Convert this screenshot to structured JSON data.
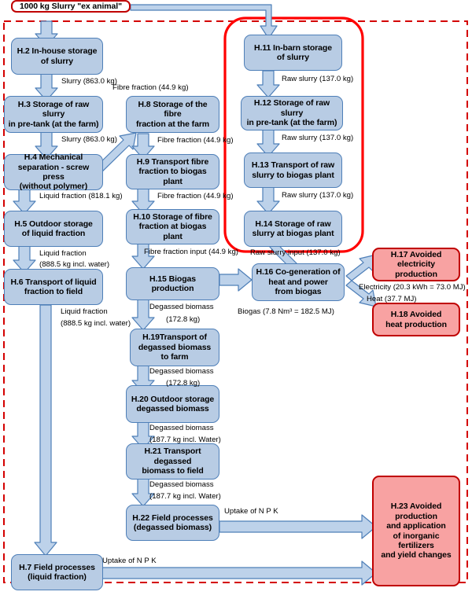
{
  "diagram": {
    "title_box": "1000 kg Slurry \"ex animal\"",
    "colors": {
      "process_fill": "#b8cce4",
      "process_border": "#4e7fb8",
      "avoided_fill": "#f8a2a2",
      "avoided_border": "#c00000",
      "system_boundary": "#d40000",
      "highlight_outline": "#ff0000",
      "arrow_fill": "#bdd2ea",
      "arrow_border": "#4e7fb8"
    },
    "nodes": [
      {
        "id": "H2",
        "label": "H.2 In-house storage\nof slurry"
      },
      {
        "id": "H3",
        "label": "H.3 Storage of raw slurry\nin pre-tank (at the farm)"
      },
      {
        "id": "H4",
        "label": "H.4 Mechanical\nseparation - screw press\n(without polymer)"
      },
      {
        "id": "H5",
        "label": "H.5 Outdoor storage\nof liquid fraction"
      },
      {
        "id": "H6",
        "label": "H.6 Transport of liquid\nfraction to field"
      },
      {
        "id": "H7",
        "label": "H.7 Field processes\n(liquid fraction)"
      },
      {
        "id": "H8",
        "label": "H.8 Storage of the fibre\nfraction at the farm"
      },
      {
        "id": "H9",
        "label": "H.9 Transport fibre\nfraction to biogas plant"
      },
      {
        "id": "H10",
        "label": "H.10 Storage of fibre\nfraction at biogas plant"
      },
      {
        "id": "H11",
        "label": "H.11 In-barn storage\nof slurry"
      },
      {
        "id": "H12",
        "label": "H.12 Storage of raw slurry\nin pre-tank (at the farm)"
      },
      {
        "id": "H13",
        "label": "H.13 Transport of raw\nslurry to biogas plant"
      },
      {
        "id": "H14",
        "label": "H.14 Storage of raw\nslurry at biogas plant"
      },
      {
        "id": "H15",
        "label": "H.15 Biogas production"
      },
      {
        "id": "H16",
        "label": "H.16 Co-generation of\nheat and power\nfrom biogas"
      },
      {
        "id": "H17",
        "label": "H.17 Avoided\nelectricity production"
      },
      {
        "id": "H18",
        "label": "H.18 Avoided\nheat production"
      },
      {
        "id": "H19",
        "label": "H.19Transport of\ndegassed biomass\nto farm"
      },
      {
        "id": "H20",
        "label": "H.20 Outdoor storage\ndegassed biomass"
      },
      {
        "id": "H21",
        "label": "H.21 Transport degassed\nbiomass to field"
      },
      {
        "id": "H22",
        "label": "H.22 Field processes\n(degassed biomass)"
      },
      {
        "id": "H23",
        "label": "H.23 Avoided\nproduction\nand application\nof inorganic fertilizers\nand yield changes"
      }
    ],
    "flows": [
      {
        "id": "f_h2_h3",
        "text": "Slurry (863.0 kg)"
      },
      {
        "id": "f_h3_h4",
        "text": "Slurry (863.0 kg)"
      },
      {
        "id": "f_h4_h5",
        "text": "Liquid fraction (818.1 kg)"
      },
      {
        "id": "f_h5_h6_a",
        "text": "Liquid fraction"
      },
      {
        "id": "f_h5_h6_b",
        "text": "(888.5 kg incl. water)"
      },
      {
        "id": "f_h6_h7_a",
        "text": "Liquid fraction"
      },
      {
        "id": "f_h6_h7_b",
        "text": "(888.5 kg incl. water)"
      },
      {
        "id": "f_h4_h8",
        "text": "Fibre fraction (44.9 kg)"
      },
      {
        "id": "f_h8_h9",
        "text": "Fibre fraction (44.9 kg)"
      },
      {
        "id": "f_h9_h10",
        "text": "Fibre fraction (44.9 kg)"
      },
      {
        "id": "f_h10_h15",
        "text": "Fibre fraction input (44.9 kg)"
      },
      {
        "id": "f_h11_h12",
        "text": "Raw slurry (137.0 kg)"
      },
      {
        "id": "f_h12_h13",
        "text": "Raw slurry (137.0 kg)"
      },
      {
        "id": "f_h13_h14",
        "text": "Raw slurry (137.0 kg)"
      },
      {
        "id": "f_h14_h15",
        "text": "Raw slurry input (137.0 kg)"
      },
      {
        "id": "f_h15_h16",
        "text": "Biogas (7.8 Nm³ = 182.5 MJ)"
      },
      {
        "id": "f_h16_h17",
        "text": "Electricity (20.3 kWh = 73.0 MJ)"
      },
      {
        "id": "f_h16_h18",
        "text": "Heat (37.7 MJ)"
      },
      {
        "id": "f_h15_h19_a",
        "text": "Degassed biomass"
      },
      {
        "id": "f_h15_h19_b",
        "text": "(172.8 kg)"
      },
      {
        "id": "f_h19_h20_a",
        "text": "Degassed biomass"
      },
      {
        "id": "f_h19_h20_b",
        "text": "(172.8 kg)"
      },
      {
        "id": "f_h20_h21_a",
        "text": "Degassed biomass"
      },
      {
        "id": "f_h20_h21_b",
        "text": "(187.7 kg incl. Water)"
      },
      {
        "id": "f_h21_h22_a",
        "text": "Degassed biomass"
      },
      {
        "id": "f_h21_h22_b",
        "text": "(187.7 kg incl. Water)"
      },
      {
        "id": "f_h22_h23",
        "text": "Uptake of N P K"
      },
      {
        "id": "f_h7_h23",
        "text": "Uptake of N P K"
      }
    ]
  }
}
